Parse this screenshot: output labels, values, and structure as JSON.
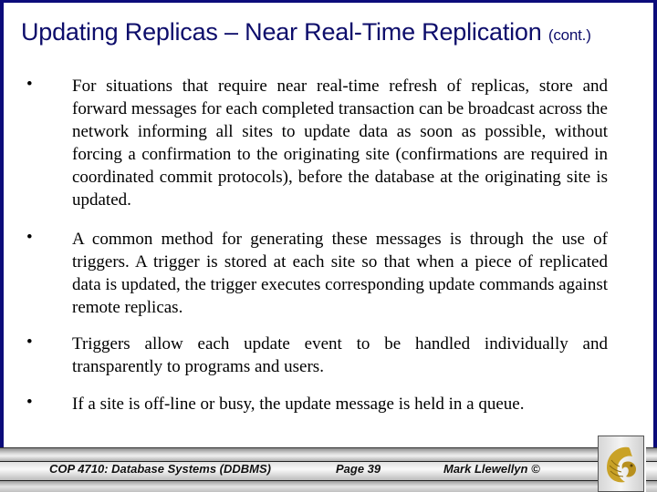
{
  "slide": {
    "title": "Updating Replicas – Near Real-Time Replication",
    "title_suffix": "(cont.)",
    "bullets": [
      {
        "marker": "•",
        "text": "For situations that require near real-time refresh of replicas, store and forward messages for each completed transaction can be broadcast across the network informing all sites to update data as soon as possible, without forcing a confirmation to the originating site (confirmations are required in coordinated commit protocols), before the database at the originating site is updated."
      },
      {
        "marker": "•",
        "text": "A common method for generating these messages is through the use of triggers.  A trigger is stored at each site so that when a piece of replicated data is updated, the trigger executes corresponding update commands against remote replicas."
      },
      {
        "marker": "•",
        "text": "Triggers allow each update event to be handled individually and transparently to programs and users."
      },
      {
        "marker": "•",
        "text": "If a site is off-line or busy, the update message is held in a queue."
      }
    ]
  },
  "footer": {
    "course": "COP 4710: Database Systems  (DDBMS)",
    "page": "Page 39",
    "author": "Mark Llewellyn ©",
    "logo": "ucf-pegasus-logo"
  },
  "colors": {
    "frame": "#0b0b7a",
    "title": "#0d0d6b",
    "logo_gold": "#c9a227"
  }
}
